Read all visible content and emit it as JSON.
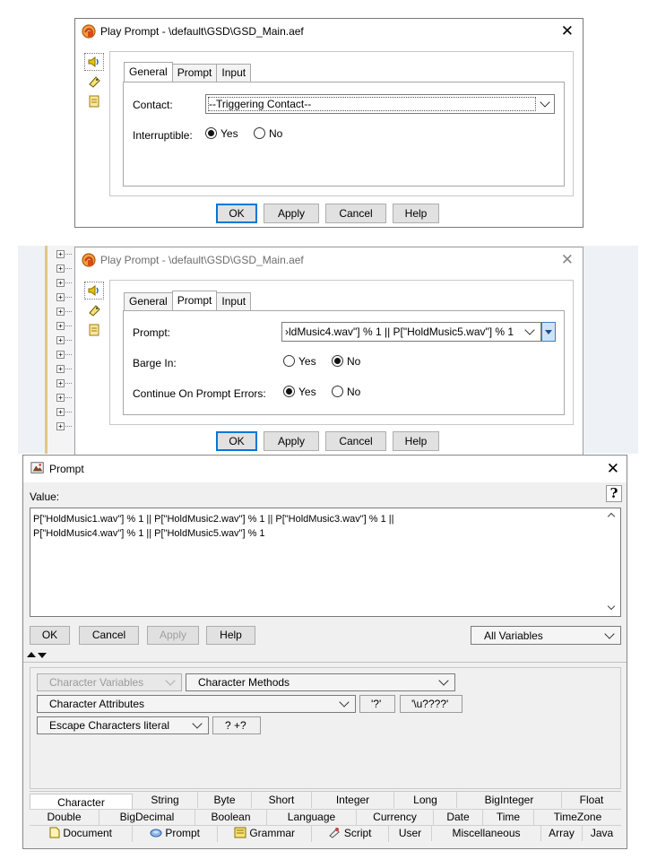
{
  "dialog1": {
    "title": "Play Prompt - \\default\\GSD\\GSD_Main.aef",
    "tabs": [
      "General",
      "Prompt",
      "Input"
    ],
    "contact_label": "Contact:",
    "contact_value": "--Triggering Contact--",
    "interruptible_label": "Interruptible:",
    "yes": "Yes",
    "no": "No",
    "buttons": {
      "ok": "OK",
      "apply": "Apply",
      "cancel": "Cancel",
      "help": "Help"
    }
  },
  "dialog2": {
    "title": "Play Prompt - \\default\\GSD\\GSD_Main.aef",
    "tabs": [
      "General",
      "Prompt",
      "Input"
    ],
    "prompt_label": "Prompt:",
    "prompt_value": "›ldMusic4.wav\"] % 1 || P[\"HoldMusic5.wav\"] % 1",
    "barge_label": "Barge In:",
    "continue_label": "Continue On Prompt Errors:",
    "yes": "Yes",
    "no": "No",
    "buttons": {
      "ok": "OK",
      "apply": "Apply",
      "cancel": "Cancel",
      "help": "Help"
    }
  },
  "prompt_dialog": {
    "title": "Prompt",
    "value_label": "Value:",
    "help_glyph": "?",
    "value_line1": "P[\"HoldMusic1.wav\"] % 1 || P[\"HoldMusic2.wav\"] % 1 || P[\"HoldMusic3.wav\"] % 1 ||",
    "value_line2": "P[\"HoldMusic4.wav\"] % 1 || P[\"HoldMusic5.wav\"] % 1",
    "buttons": {
      "ok": "OK",
      "cancel": "Cancel",
      "apply": "Apply",
      "help": "Help"
    },
    "variables_select": "All Variables",
    "char_variables": "Character Variables",
    "char_methods": "Character Methods",
    "char_attributes": "Character Attributes",
    "btn_q": "'?'",
    "btn_u": "'\\u????'",
    "escape_select": "Escape Characters literal",
    "btn_ternary": "? +?",
    "type_tabs_row1": [
      "Character",
      "String",
      "Byte",
      "Short",
      "Integer",
      "Long",
      "BigInteger",
      "Float"
    ],
    "type_tabs_row2": [
      "Double",
      "BigDecimal",
      "Boolean",
      "Language",
      "Currency",
      "Date",
      "Time",
      "TimeZone"
    ],
    "type_tabs_row3": [
      "Document",
      "Prompt",
      "Grammar",
      "Script",
      "User",
      "Miscellaneous",
      "Array",
      "Java"
    ]
  },
  "colors": {
    "accent": "#0078d7",
    "title_text_inactive": "#6d6d6d",
    "panel_bg": "#f0f0f0"
  },
  "icons": [
    "speaker-icon",
    "tag-icon",
    "notepad-icon",
    "close-icon",
    "chevron-down-icon"
  ]
}
